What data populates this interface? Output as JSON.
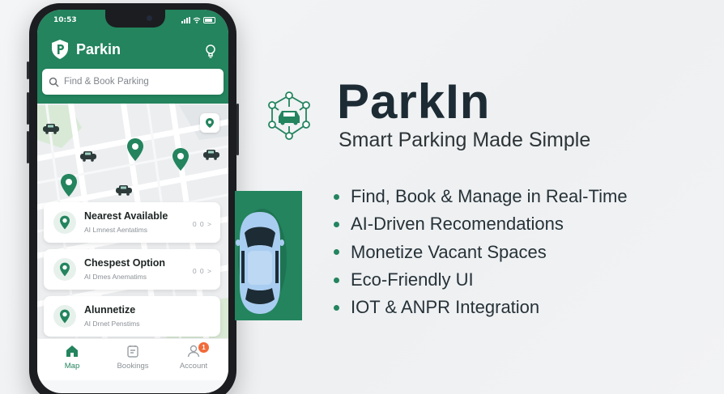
{
  "status_bar": {
    "time": "10:53"
  },
  "app": {
    "name": "Parkin"
  },
  "search": {
    "placeholder": "Find & Book Parking"
  },
  "cards": [
    {
      "title": "Nearest Available",
      "subtitle": "AI Lmnest Aentatims",
      "meta": "0 0 >"
    },
    {
      "title": "Chespest Option",
      "subtitle": "AI Dmes Anematims",
      "meta": "0 0 >"
    },
    {
      "title": "Alunnetize",
      "subtitle": "AI Drnet Penstims",
      "meta": ""
    }
  ],
  "tabs": [
    {
      "label": "Map",
      "icon": "home-icon",
      "active": true
    },
    {
      "label": "Bookings",
      "icon": "bookings-icon",
      "active": false
    },
    {
      "label": "Account",
      "icon": "account-icon",
      "active": false,
      "badge": "1"
    }
  ],
  "hero": {
    "title": "ParkIn",
    "subtitle": "Smart Parking Made Simple",
    "features": [
      "Find, Book & Manage in Real-Time",
      "AI-Driven Recomendations",
      "Monetize Vacant Spaces",
      "Eco-Friendly UI",
      "IOT & ANPR Integration"
    ]
  },
  "colors": {
    "brand": "#23845e",
    "badge": "#f26b3a",
    "title": "#1d2b34"
  }
}
